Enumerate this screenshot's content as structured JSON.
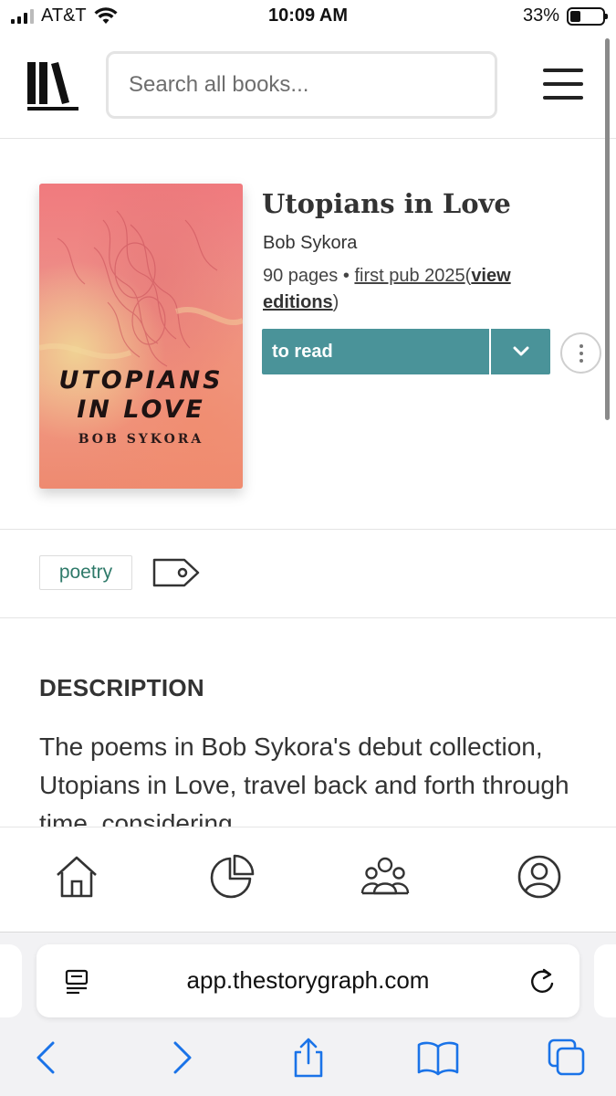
{
  "status_bar": {
    "carrier": "AT&T",
    "time": "10:09 AM",
    "battery": "33%",
    "battery_level": 0.33
  },
  "header": {
    "search_placeholder": "Search all books...",
    "icons": [
      "storygraph-logo-icon",
      "hamburger-menu-icon"
    ]
  },
  "book": {
    "title": "Utopians in Love",
    "author": "Bob Sykora",
    "pages": "90 pages",
    "separator": "•",
    "first_pub": "first pub 2025",
    "paren_open": "(",
    "view_editions": "view editions",
    "paren_close": ")",
    "cover": {
      "title_line1": "UTOPIANS",
      "title_line2": "IN LOVE",
      "author": "BOB SYKORA"
    },
    "status_button": "to read"
  },
  "tags": {
    "items": [
      "poetry"
    ]
  },
  "description": {
    "heading": "DESCRIPTION",
    "text": "The poems in Bob Sykora's debut collection, Utopians in Love, travel back and forth through time, considering"
  },
  "app_nav": {
    "items": [
      "home-icon",
      "stats-pie-icon",
      "community-icon",
      "profile-icon"
    ]
  },
  "browser": {
    "url": "app.thestorygraph.com",
    "toolbar": [
      "back-icon",
      "forward-icon",
      "share-icon",
      "bookmarks-icon",
      "tabs-icon"
    ]
  },
  "colors": {
    "accent_teal": "#4a9399",
    "tag_green": "#2f7a6a",
    "ios_blue": "#1a73e8"
  }
}
